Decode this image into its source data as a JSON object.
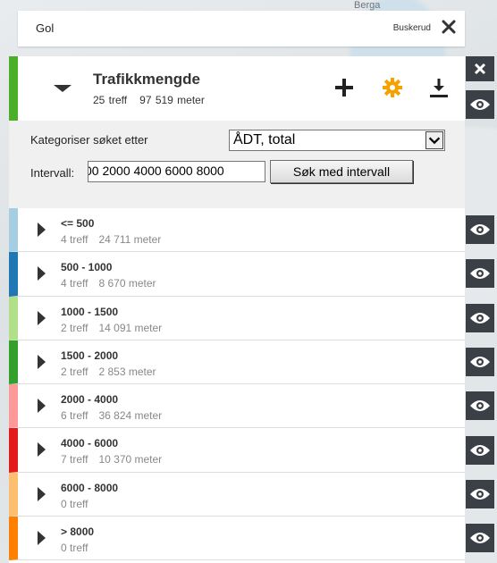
{
  "map": {
    "labels": [
      "Buskerud"
    ]
  },
  "search": {
    "query": "Gol",
    "region": "Buskerud"
  },
  "layer": {
    "title": "Trafikkmengde",
    "hits": "25 treff",
    "length": "97 519 meter",
    "color": "#4caf28"
  },
  "filter": {
    "categorize_label": "Kategoriser søket etter",
    "categorize_value": "ÅDT, total",
    "interval_label": "Intervall:",
    "interval_value": "00 2000 4000 6000 8000",
    "interval_button": "Søk med intervall"
  },
  "categories": [
    {
      "label": "<= 500",
      "hits": "4 treff",
      "length": "24 711 meter",
      "color": "#a6cee3"
    },
    {
      "label": "500 - 1000",
      "hits": "4 treff",
      "length": "8 670 meter",
      "color": "#1f78b4"
    },
    {
      "label": "1000 - 1500",
      "hits": "2 treff",
      "length": "14 091 meter",
      "color": "#b2df8a"
    },
    {
      "label": "1500 - 2000",
      "hits": "2 treff",
      "length": "2 853 meter",
      "color": "#33a02c"
    },
    {
      "label": "2000 - 4000",
      "hits": "6 treff",
      "length": "36 824 meter",
      "color": "#fb9a99"
    },
    {
      "label": "4000 - 6000",
      "hits": "7 treff",
      "length": "10 370 meter",
      "color": "#e31a1c"
    },
    {
      "label": "6000 - 8000",
      "hits": "0 treff",
      "length": "",
      "color": "#fdbf6f"
    },
    {
      "label": "> 8000",
      "hits": "0 treff",
      "length": "",
      "color": "#ff7f00"
    }
  ],
  "colors": {
    "rail": "#3a4046",
    "gear": "#f5a200"
  }
}
